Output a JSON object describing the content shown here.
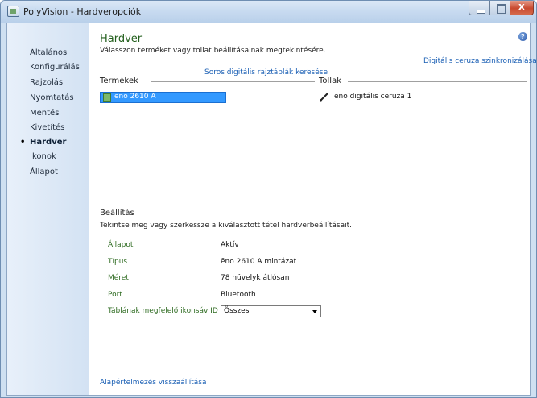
{
  "window": {
    "title": "PolyVision - Hardveropciók"
  },
  "sidebar": {
    "items": [
      {
        "label": "Általános",
        "active": false
      },
      {
        "label": "Konfigurálás",
        "active": false
      },
      {
        "label": "Rajzolás",
        "active": false
      },
      {
        "label": "Nyomtatás",
        "active": false
      },
      {
        "label": "Mentés",
        "active": false
      },
      {
        "label": "Kivetítés",
        "active": false
      },
      {
        "label": "Hardver",
        "active": true
      },
      {
        "label": "Ikonok",
        "active": false
      },
      {
        "label": "Állapot",
        "active": false
      }
    ],
    "bullet": "•"
  },
  "main": {
    "title": "Hardver",
    "subtitle": "Válasszon terméket vagy tollat beállításainak megtekintésére.",
    "sync_link": "Digitális ceruza szinkronizálása",
    "search_link": "Soros digitális rajztáblák keresése",
    "help_glyph": "?",
    "products_label": "Termékek",
    "products": [
      "ēno 2610 A"
    ],
    "pens_label": "Tollak",
    "pens": [
      "ēno digitális ceruza 1"
    ],
    "settings_label": "Beállítás",
    "settings_desc": "Tekintse meg vagy szerkessze a kiválasztott tétel hardverbeállításait.",
    "properties": [
      {
        "label": "Állapot",
        "value": "Aktív"
      },
      {
        "label": "Típus",
        "value": "ēno 2610 A mintázat"
      },
      {
        "label": "Méret",
        "value": "78  hüvelyk átlósan"
      },
      {
        "label": "Port",
        "value": "Bluetooth"
      }
    ],
    "iconbar_label": "Táblának megfelelő ikonsáv ID",
    "iconbar_value": "Összes",
    "reset_link": "Alapértelmezés visszaállítása"
  },
  "colors": {
    "accent_green": "#235f1d",
    "link_blue": "#1a5fb4",
    "selection_blue": "#3399ff"
  }
}
